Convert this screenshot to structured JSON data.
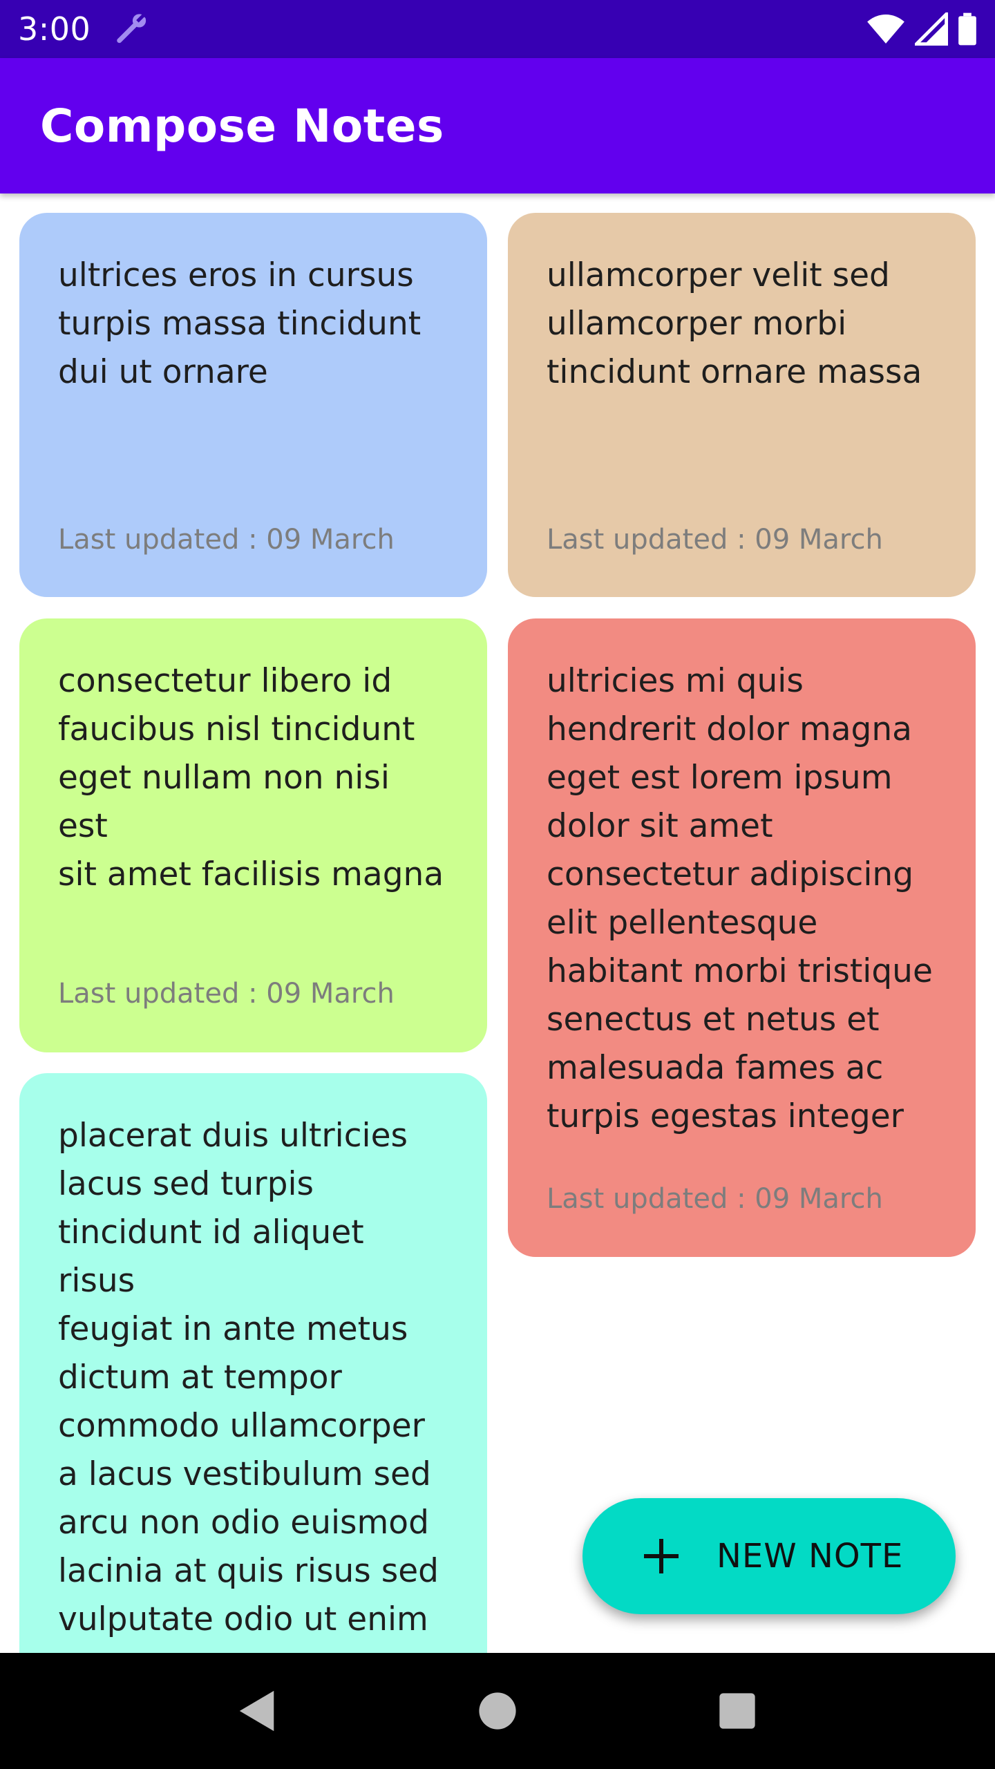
{
  "status_bar": {
    "time": "3:00",
    "icons": [
      "wrench-icon",
      "wifi-icon",
      "signal-icon",
      "battery-icon"
    ]
  },
  "app_bar": {
    "title": "Compose Notes"
  },
  "notes": [
    {
      "text": "ultrices eros in cursus\nturpis massa tincidunt\ndui ut ornare",
      "date": "Last updated : 09 March",
      "color": "#aecbfa"
    },
    {
      "text": "ullamcorper velit sed\nullamcorper morbi\ntincidunt ornare massa",
      "date": "Last updated : 09 March",
      "color": "#e6c9a8"
    },
    {
      "text": "consectetur libero id\nfaucibus nisl tincidunt\neget nullam non nisi est\nsit amet facilisis magna",
      "date": "Last updated : 09 March",
      "color": "#ccff90"
    },
    {
      "text": "ultricies mi quis\nhendrerit dolor magna\neget est lorem ipsum\ndolor sit amet\nconsectetur adipiscing\nelit pellentesque\nhabitant morbi tristique\nsenectus et netus et\nmalesuada fames ac\nturpis egestas integer",
      "date": "Last updated : 09 March",
      "color": "#f28b82"
    },
    {
      "text": "placerat duis ultricies\nlacus sed turpis\ntincidunt id aliquet risus\nfeugiat in ante metus\ndictum at tempor\ncommodo ullamcorper\na lacus vestibulum sed\narcu non odio euismod\nlacinia at quis risus sed\nvulputate odio ut enim\nblandit volutpat",
      "date": "",
      "color": "#a7ffeb"
    }
  ],
  "fab": {
    "label": "NEW NOTE",
    "icon": "plus-icon",
    "color": "#03dac5"
  },
  "nav_bar": {
    "icons": [
      "back-icon",
      "home-icon",
      "recents-icon"
    ]
  },
  "colors": {
    "status_bar": "#3700b3",
    "app_bar": "#6200ee"
  }
}
